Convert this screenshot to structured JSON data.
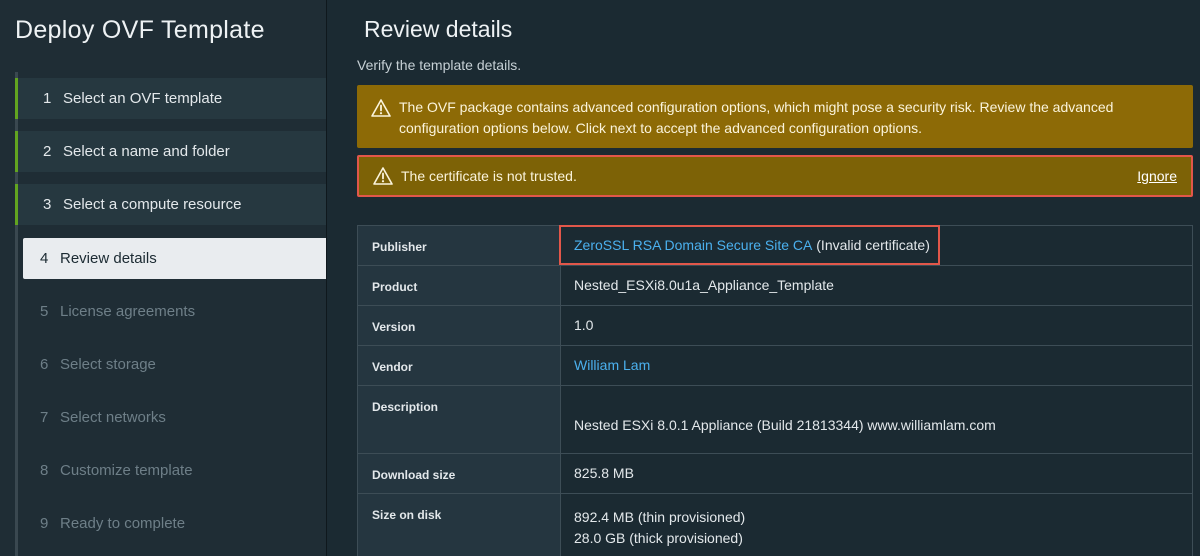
{
  "wizard": {
    "title": "Deploy OVF Template",
    "steps": [
      {
        "num": "1",
        "label": "Select an OVF template",
        "state": "done"
      },
      {
        "num": "2",
        "label": "Select a name and folder",
        "state": "done"
      },
      {
        "num": "3",
        "label": "Select a compute resource",
        "state": "done"
      },
      {
        "num": "4",
        "label": "Review details",
        "state": "active"
      },
      {
        "num": "5",
        "label": "License agreements",
        "state": "pending"
      },
      {
        "num": "6",
        "label": "Select storage",
        "state": "pending"
      },
      {
        "num": "7",
        "label": "Select networks",
        "state": "pending"
      },
      {
        "num": "8",
        "label": "Customize template",
        "state": "pending"
      },
      {
        "num": "9",
        "label": "Ready to complete",
        "state": "pending"
      }
    ]
  },
  "main": {
    "title": "Review details",
    "subtitle": "Verify the template details.",
    "alerts": {
      "advanced": "The OVF package contains advanced configuration options, which might pose a security risk. Review the advanced configuration options below. Click next to accept the advanced configuration options.",
      "certificate": "The certificate is not trusted.",
      "ignore_label": "Ignore"
    },
    "details": {
      "publisher": {
        "key": "Publisher",
        "link": "ZeroSSL RSA Domain Secure Site CA",
        "suffix": " (Invalid certificate)"
      },
      "product": {
        "key": "Product",
        "value": "Nested_ESXi8.0u1a_Appliance_Template"
      },
      "version": {
        "key": "Version",
        "value": "1.0"
      },
      "vendor": {
        "key": "Vendor",
        "link": "William Lam"
      },
      "description": {
        "key": "Description",
        "value": "Nested ESXi 8.0.1 Appliance (Build 21813344) www.williamlam.com"
      },
      "download_size": {
        "key": "Download size",
        "value": "825.8 MB"
      },
      "size_on_disk": {
        "key": "Size on disk",
        "thin": "892.4 MB (thin provisioned)",
        "thick": "28.0 GB (thick provisioned)"
      }
    }
  },
  "colors": {
    "completed_step_bar": "#62a420",
    "warning_banner": "#8d6a06",
    "highlight_outline": "#e2574a",
    "link": "#4bb0ee"
  }
}
